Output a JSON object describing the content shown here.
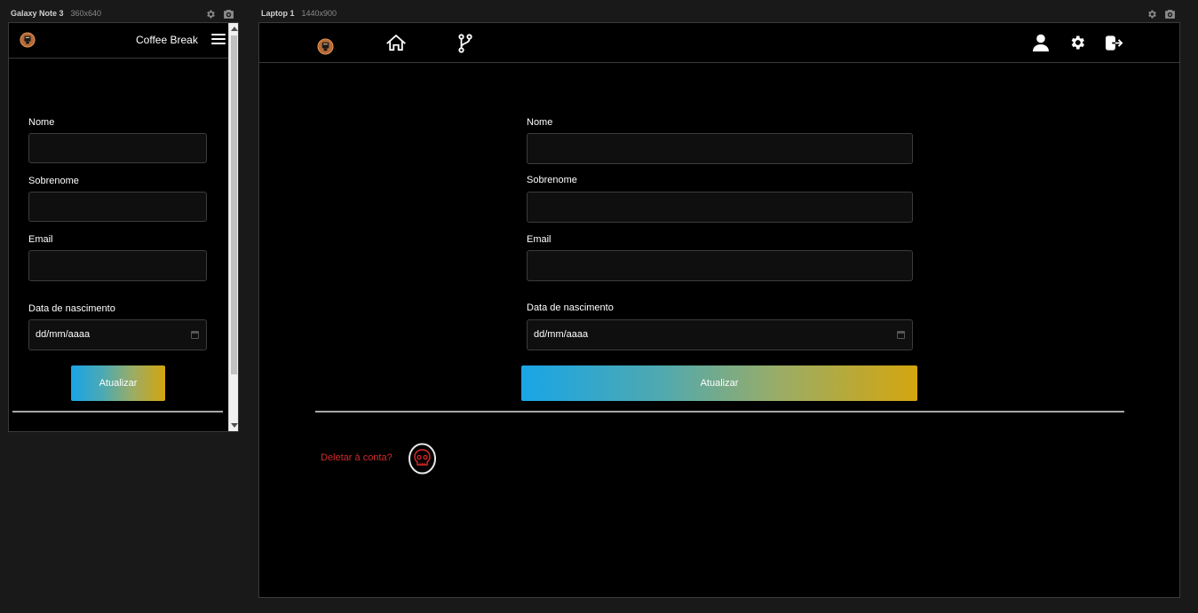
{
  "devices": {
    "mobile": {
      "name": "Galaxy Note 3",
      "dimensions": "360x640"
    },
    "laptop": {
      "name": "Laptop 1",
      "dimensions": "1440x900"
    }
  },
  "toolbar_icons": [
    "gear-icon",
    "camera-icon"
  ],
  "app": {
    "brand": "Coffee Break",
    "logo_icon": "coffee-logo-icon",
    "nav_icons": [
      "home-icon",
      "git-branch-icon",
      "user-icon",
      "gear-icon",
      "logout-icon"
    ],
    "menu_icon": "hamburger-menu-icon"
  },
  "form": {
    "nome_label": "Nome",
    "sobrenome_label": "Sobrenome",
    "email_label": "Email",
    "nascimento_label": "Data de nascimento",
    "nascimento_placeholder": "dd/mm/aaaa",
    "submit_label": "Atualizar"
  },
  "danger": {
    "delete_text": "Deletar à conta?",
    "delete_icon": "skull-icon"
  },
  "colors": {
    "background": "#000000",
    "delete_text": "#d32a2a",
    "gradient_start": "#19a5e6",
    "gradient_end": "#d4a60f"
  }
}
